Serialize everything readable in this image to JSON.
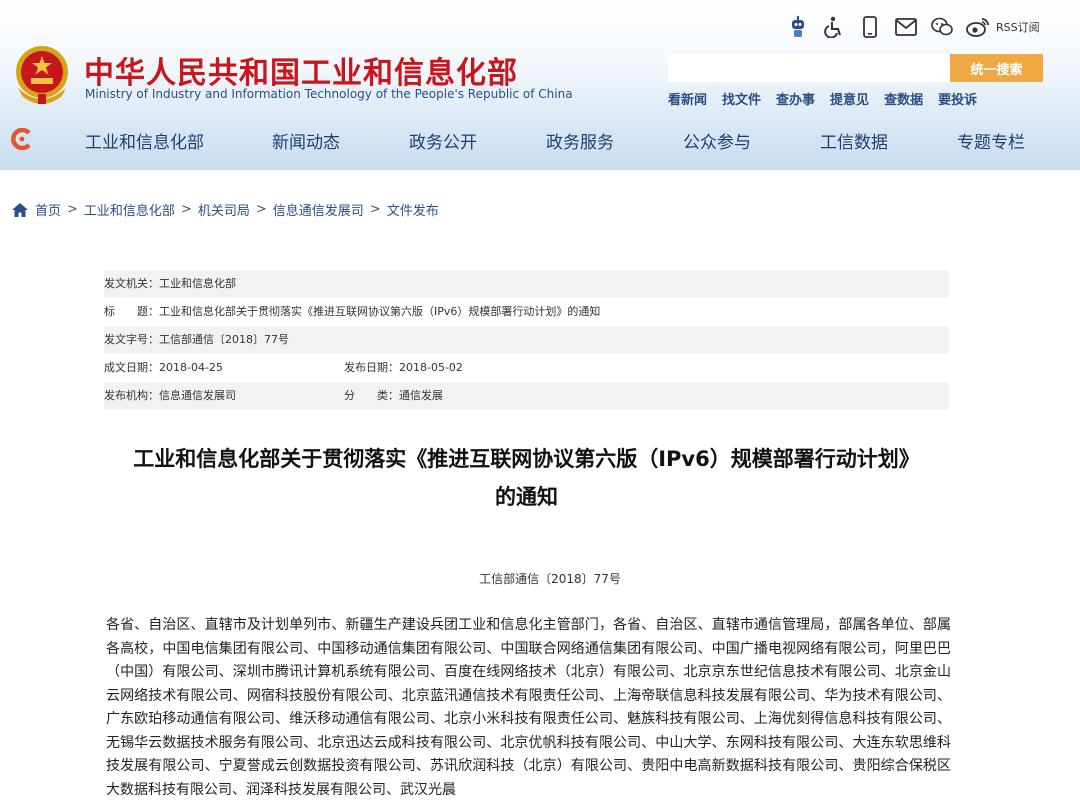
{
  "header": {
    "site_title": "中华人民共和国工业和信息化部",
    "site_subtitle": "Ministry of Industry and Information Technology of the People's Republic of China",
    "top_icons": [
      "robot-icon",
      "accessibility-icon",
      "mobile-icon",
      "mail-icon",
      "wechat-icon",
      "weibo-icon"
    ],
    "rss_label": "RSS订阅",
    "search": {
      "placeholder": "",
      "value": "",
      "button_label": "统一搜索"
    },
    "quick_links": [
      "看新闻",
      "找文件",
      "查办事",
      "提意见",
      "查数据",
      "要投诉"
    ]
  },
  "nav": {
    "items": [
      "工业和信息化部",
      "新闻动态",
      "政务公开",
      "政务服务",
      "公众参与",
      "工信数据",
      "专题专栏"
    ]
  },
  "breadcrumb": {
    "items": [
      "首页",
      "工业和信息化部",
      "机关司局",
      "信息通信发展司",
      "文件发布"
    ],
    "separator": ">"
  },
  "meta": {
    "issuer_label": "发文机关：",
    "issuer": "工业和信息化部",
    "title_label": "标　　题：",
    "title": "工业和信息化部关于贯彻落实《推进互联网协议第六版（IPv6）规模部署行动计划》的通知",
    "number_label": "发文字号：",
    "number": "工信部通信〔2018〕77号",
    "created_label": "成文日期：",
    "created": "2018-04-25",
    "published_label": "发布日期：",
    "published": "2018-05-02",
    "agency_label": "发布机构：",
    "agency": "信息通信发展司",
    "category_label": "分　　类：",
    "category": "通信发展"
  },
  "document": {
    "title_line1": "工业和信息化部关于贯彻落实《推进互联网协议第六版（IPv6）规模部署行动计划》",
    "title_line2": "的通知",
    "number": "工信部通信〔2018〕77号",
    "body": "各省、自治区、直辖市及计划单列市、新疆生产建设兵团工业和信息化主管部门，各省、自治区、直辖市通信管理局，部属各单位、部属各高校，中国电信集团有限公司、中国移动通信集团有限公司、中国联合网络通信集团有限公司、中国广播电视网络有限公司，阿里巴巴（中国）有限公司、深圳市腾讯计算机系统有限公司、百度在线网络技术（北京）有限公司、北京京东世纪信息技术有限公司、北京金山云网络技术有限公司、网宿科技股份有限公司、北京蓝汛通信技术有限责任公司、上海帝联信息科技发展有限公司、华为技术有限公司、广东欧珀移动通信有限公司、维沃移动通信有限公司、北京小米科技有限责任公司、魅族科技有限公司、上海优刻得信息科技有限公司、无锡华云数据技术服务有限公司、北京迅达云成科技有限公司、北京优帆科技有限公司、中山大学、东网科技有限公司、大连东软思维科技发展有限公司、宁夏誉成云创数据投资有限公司、苏讯欣润科技（北京）有限公司、贵阳中电高新数据科技有限公司、贵阳综合保税区大数据科技有限公司、润泽科技发展有限公司、武汉光晨"
  },
  "colors": {
    "brand_red": "#c8161d",
    "link_blue": "#2b4f86",
    "search_button": "#f0a843"
  }
}
